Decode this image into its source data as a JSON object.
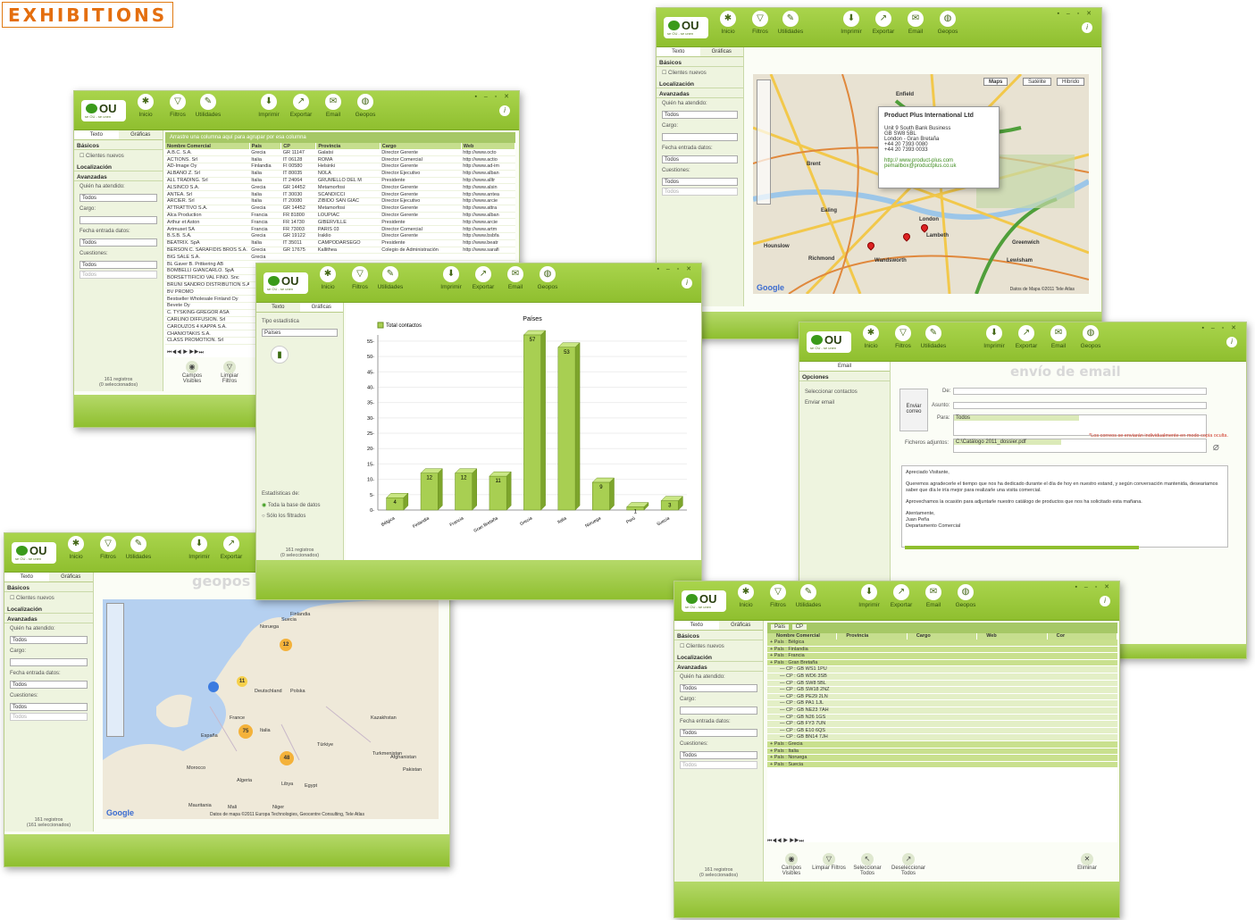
{
  "brand": "EXHIBITIONS",
  "logo": {
    "name": "OU",
    "sub": "se OU - se unen"
  },
  "toolbar": {
    "inicio": "Inicio",
    "filtros": "Filtros",
    "utilidades": "Utilidades",
    "imprimir": "Imprimir",
    "exportar": "Exportar",
    "email": "Email",
    "geopos": "Geopos"
  },
  "tabs": {
    "texto": "Texto",
    "graficas": "Gráficas",
    "email": "Email"
  },
  "sidebar": {
    "basicos": "Básicos",
    "clientes_nuevos": "Clientes nuevos",
    "localizacion": "Localización",
    "avanzadas": "Avanzadas",
    "quien": "Quién ha atendido:",
    "cargo": "Cargo:",
    "fecha": "Fecha entrada datos:",
    "cuestiones": "Cuestiones:",
    "todos": "Todos"
  },
  "grid": {
    "group_hint": "Arrastre una columna aquí para agrupar por esa columna",
    "columns": [
      "Nombre Comercial",
      "País",
      "CP",
      "Provincia",
      "Cargo",
      "Web"
    ],
    "rows": [
      [
        "A.B.C. S.A.",
        "Grecia",
        "GR 11147",
        "Galatsi",
        "Director Gerente",
        "http://www.octo"
      ],
      [
        "ACTIONS. Srl",
        "Italia",
        "IT 06128",
        "ROMA",
        "Director Comercial",
        "http://www.actio"
      ],
      [
        "AD-Image Oy",
        "Finlandia",
        "FI 00580",
        "Helsinki",
        "Director Gerente",
        "http://www.ad-im"
      ],
      [
        "ALBANO Z. Srl",
        "Italia",
        "IT 80035",
        "NOLA",
        "Director Ejecutivo",
        "http://www.alban"
      ],
      [
        "ALL TRADING. Srl",
        "Italia",
        "IT 24064",
        "GRUMELLO DEL M",
        "Presidente",
        "http://www.alltr"
      ],
      [
        "ALSINCO S.A.",
        "Grecia",
        "GR 14452",
        "Metamorfosi",
        "Director Gerente",
        "http://www.alsin"
      ],
      [
        "ANTEA. Srl",
        "Italia",
        "IT 30030",
        "SCANDICCI",
        "Director Gerente",
        "http://www.antea"
      ],
      [
        "ARCIER. Srl",
        "Italia",
        "IT 20080",
        "ZIBIDO SAN GIAC",
        "Director Ejecutivo",
        "http://www.arcie"
      ],
      [
        "ATTRATTIVO S.A.",
        "Grecia",
        "GR 14452",
        "Metamorfosi",
        "Director Gerente",
        "http://www.attra"
      ],
      [
        "Alca Production",
        "Francia",
        "FR 81800",
        "LOUPIAC",
        "Director Gerente",
        "http://www.alban"
      ],
      [
        "Arthur et Aston",
        "Francia",
        "FR 14730",
        "GIBERVILLE",
        "Presidente",
        "http://www.arcie"
      ],
      [
        "Artmuset SA",
        "Francia",
        "FR 73003",
        "PARIS 03",
        "Director Comercial",
        "http://www.artm"
      ],
      [
        "B.S.B. S.A.",
        "Grecia",
        "GR 19122",
        "Iraklio",
        "Director Gerente",
        "http://www.bsbfa"
      ],
      [
        "BEATRIX. SpA",
        "Italia",
        "IT 35011",
        "CAMPODARSEGO",
        "Presidente",
        "http://www.beatr"
      ],
      [
        "BERSON C. SARAFIDIS BROS S.A.",
        "Grecia",
        "GR 17675",
        "Kallithea",
        "Colegio de Administración",
        "http://www.sarafi"
      ],
      [
        "BIG SALE S.A.",
        "Grecia",
        "",
        "",
        "",
        ""
      ],
      [
        "BL Gaver B. Pritkering AB",
        "",
        "",
        "",
        "",
        ""
      ],
      [
        "BOMBELLI GIANCARLO. SpA",
        "",
        "",
        "",
        "",
        ""
      ],
      [
        "BORSETTIFICIO VAL FINO. Snc",
        "",
        "",
        "",
        "",
        ""
      ],
      [
        "BRUNI SANDRO DISTRIBUTION S.A.",
        "",
        "",
        "",
        "",
        ""
      ],
      [
        "BV PROMO",
        "",
        "",
        "",
        "",
        ""
      ],
      [
        "Bestseller Wholesale Finland Oy",
        "",
        "",
        "",
        "",
        ""
      ],
      [
        "Bevete Oy",
        "",
        "",
        "",
        "",
        ""
      ],
      [
        "C. TYSKING-GREGOR ASA",
        "",
        "",
        "",
        "",
        ""
      ],
      [
        "CARLINO DIFFUSION. Srl",
        "",
        "",
        "",
        "",
        ""
      ],
      [
        "CAROUZOS 4 KAPPA S.A.",
        "",
        "",
        "",
        "",
        ""
      ],
      [
        "CHANIOTAKIS S.A.",
        "",
        "",
        "",
        "",
        ""
      ],
      [
        "CLASS PROMOTION. Srl",
        "",
        "",
        "",
        "",
        ""
      ]
    ],
    "count": "161 registros",
    "selected": "(0 seleccionados)",
    "campos": "Campos Visibles",
    "limpiar": "Limpiar Filtros"
  },
  "chart_window": {
    "tipo_label": "Tipo estadística",
    "tipo_value": "Países",
    "stats_label": "Estadísticas de:",
    "opt1": "Toda la base de datos",
    "opt2": "Sólo los filtrados",
    "count": "161 registros",
    "selected": "(0 seleccionados)"
  },
  "chart_data": {
    "type": "bar",
    "title": "Países",
    "legend": "Total contactos",
    "categories": [
      "Bélgica",
      "Finlandia",
      "Francia",
      "Gran Bretaña",
      "Grecia",
      "Italia",
      "Noruega",
      "Perú",
      "Suecia"
    ],
    "values": [
      4,
      12,
      12,
      11,
      57,
      53,
      9,
      1,
      3
    ],
    "ylim": [
      0,
      57
    ],
    "yticks": [
      0,
      5,
      10,
      15,
      20,
      25,
      30,
      35,
      40,
      45,
      50,
      55
    ],
    "color": "#a8cf52"
  },
  "london_map": {
    "maps": "Maps",
    "satelite": "Satélite",
    "hibrido": "Híbrido",
    "popup_title": "Product Plus International Ltd",
    "popup_lines": [
      "Unit 9 South Bank Business",
      "GB SW8 5BL",
      "London - Gran Bretaña",
      "+44 20 7393 0080",
      "+44 20 7393 0033"
    ],
    "popup_links": [
      "http:// www.product-plus.com",
      "pemailbox@productplus.co.uk"
    ],
    "places": [
      "London",
      "Lambeth",
      "Wandsworth",
      "Greenwich",
      "Lewisham",
      "Hounslow",
      "Brent",
      "Ealing",
      "Enfield",
      "Richmond"
    ],
    "copyright": "Datos de Mapa ©2011 Tele Atlas"
  },
  "europe_map": {
    "title": "geopos",
    "clusters": [
      "12",
      "11",
      "75",
      "48"
    ],
    "countries": [
      "Noruega",
      "Suecia",
      "Finlandia",
      "Deutschland",
      "Polska",
      "France",
      "España",
      "Italia",
      "Türkiye",
      "Kazakhstan",
      "Algeria",
      "Libya",
      "Egypt",
      "Morocco",
      "Turkmenistan",
      "Afghanistan",
      "Pakistan",
      "Mauritania",
      "Mali",
      "Niger"
    ],
    "copyright": "Datos de mapa ©2011 Europa Technologies, Geocentre Consulting, Tele Atlas",
    "count": "161 registros",
    "selected": "(161 seleccionados)"
  },
  "email": {
    "title": "envío de email",
    "opciones": "Opciones",
    "sel": "Seleccionar contactos",
    "env": "Enviar email",
    "enviar": "Enviar correo",
    "de": "De:",
    "asunto": "Asunto:",
    "para": "Para:",
    "para_value": "Todos",
    "warning": "*Los correos se enviarán individualmente en modo copia oculta.",
    "adjuntos": "Ficheros adjuntos:",
    "adjunto_value": "C:\\Catálogo 2011_dossier.pdf",
    "body": [
      "Apreciado Visitante,",
      "Queremos agradecerle el tiempo que nos ha dedicado durante el día de hoy en nuestro estand, y según conversación mantenida, deseariamos saber que día le iría mejor para realizarle una visita comercial.",
      "Aprovechamos la ocasión para adjuntarle nuestro catálogo de productos que nos ha solicitado esta mañana.",
      "Atentamente,",
      "Juan Peña",
      "Departamento Comercial"
    ]
  },
  "group": {
    "chips": [
      "País",
      "CP"
    ],
    "columns": [
      "Nombre Comercial",
      "Provincia",
      "Cargo",
      "Web",
      "Cor"
    ],
    "rows": [
      "País : Bélgica",
      "País : Finlandia",
      "País : Francia",
      "País : Gran Bretaña",
      "CP : GB WS1 1PU",
      "CP : GB WD6 3SB",
      "CP : GB SW8 5BL",
      "CP : GB SW18 2NZ",
      "CP : GB PE29 2LN",
      "CP : GB PA1 1JL",
      "CP : GB NE23 7AH",
      "CP : GB N26 1GS",
      "CP : GB FY3 7UN",
      "CP : GB E10 6QS",
      "CP : GB BN14 7JH",
      "País : Grecia",
      "País : Italia",
      "País : Noruega",
      "País : Suecia"
    ],
    "count": "161 registros",
    "selected": "(0 seleccionados)",
    "seleccionar": "Seleccionar Todos",
    "deseleccionar": "Deseleccionar Todos",
    "eliminar": "Eliminar"
  }
}
